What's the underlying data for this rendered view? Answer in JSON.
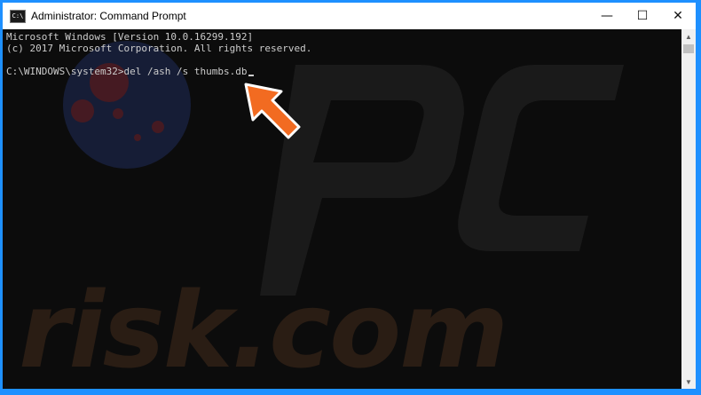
{
  "window": {
    "title": "Administrator: Command Prompt",
    "icon": "cmd-icon",
    "icon_label": "C:\\",
    "minimize_glyph": "—",
    "maximize_glyph": "☐",
    "close_glyph": "✕"
  },
  "console": {
    "lines": [
      "Microsoft Windows [Version 10.0.16299.192]",
      "(c) 2017 Microsoft Corporation. All rights reserved.",
      "",
      "C:\\WINDOWS\\system32>del /ash /s thumbs.db"
    ],
    "text_color": "#cccccc",
    "background": "#0c0c0c"
  },
  "scrollbar": {
    "up_glyph": "▲",
    "down_glyph": "▼"
  },
  "watermark": {
    "text": "risk.com"
  },
  "annotation": {
    "icon": "arrow-pointer-icon",
    "color": "#f26b21"
  },
  "colors": {
    "window_border": "#1e90ff",
    "titlebar_bg": "#ffffff"
  }
}
